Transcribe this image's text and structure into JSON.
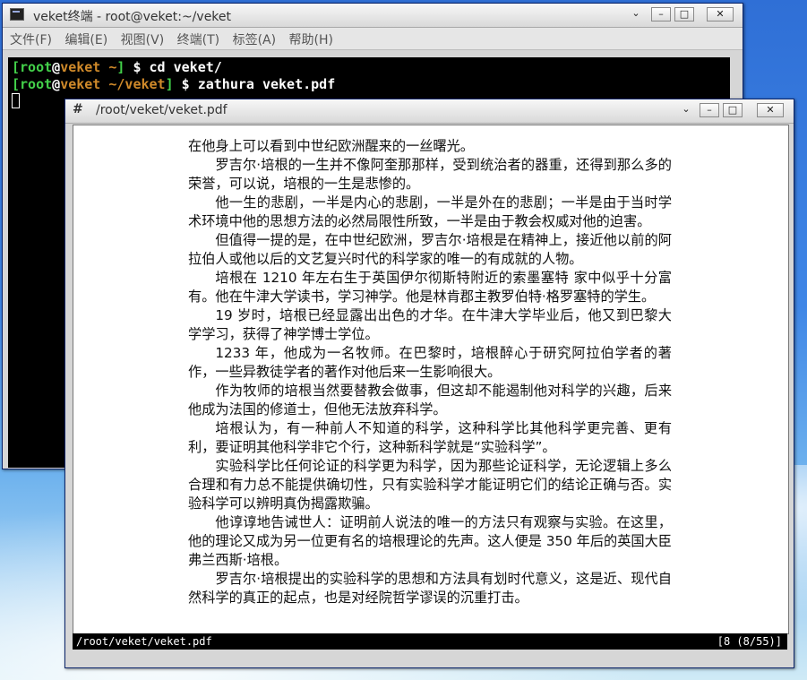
{
  "terminal": {
    "title": "veket终端 - root@veket:~/veket",
    "menu": [
      "文件(F)",
      "编辑(E)",
      "视图(V)",
      "终端(T)",
      "标签(A)",
      "帮助(H)"
    ],
    "lines": [
      {
        "bracket_open": "[",
        "user": "root",
        "at": "@",
        "host": "veket",
        "path": " ~",
        "bracket_close": "]",
        "prompt": " $ ",
        "command": "cd veket/"
      },
      {
        "bracket_open": "[",
        "user": "root",
        "at": "@",
        "host": "veket",
        "path": " ~/veket",
        "bracket_close": "]",
        "prompt": " $ ",
        "command": "zathura veket.pdf"
      }
    ]
  },
  "viewer": {
    "title": "/root/veket/veket.pdf",
    "title_glyph": "#",
    "status_path": "/root/veket/veket.pdf",
    "status_page": "[8 (8/55)]",
    "paragraphs": [
      "在他身上可以看到中世纪欧洲醒来的一丝曙光。",
      "罗吉尔·培根的一生并不像阿奎那那样，受到统治者的器重，还得到那么多的荣誉，可以说，培根的一生是悲惨的。",
      "他一生的悲剧，一半是内心的悲剧，一半是外在的悲剧；一半是由于当时学术环境中他的思想方法的必然局限性所致，一半是由于教会权威对他的迫害。",
      "但值得一提的是，在中世纪欧洲，罗吉尔·培根是在精神上，接近他以前的阿拉伯人或他以后的文艺复兴时代的科学家的唯一的有成就的人物。",
      "培根在 1210 年左右生于英国伊尔彻斯特附近的索墨塞特 家中似乎十分富有。他在牛津大学读书，学习神学。他是林肯郡主教罗伯特·格罗塞特的学生。",
      "19 岁时，培根已经显露出出色的才华。在牛津大学毕业后，他又到巴黎大学学习，获得了神学博士学位。",
      "1233 年，他成为一名牧师。在巴黎时，培根醉心于研究阿拉伯学者的著作，一些异教徒学者的著作对他后来一生影响很大。",
      "作为牧师的培根当然要替教会做事，但这却不能遏制他对科学的兴趣，后来他成为法国的修道士，但他无法放弃科学。",
      "培根认为，有一种前人不知道的科学，这种科学比其他科学更完善、更有利，要证明其他科学非它个行，这种新科学就是“实验科学”。",
      "实验科学比任何论证的科学更为科学，因为那些论证科学，无论逻辑上多么合理和有力总不能提供确切性，只有实验科学才能证明它们的结论正确与否。实验科学可以辨明真伪揭露欺骗。",
      "他谆谆地告诫世人：证明前人说法的唯一的方法只有观察与实验。在这里，他的理论又成为另一位更有名的培根理论的先声。这人便是 350 年后的英国大臣弗兰西斯·培根。",
      "罗吉尔·培根提出的实验科学的思想和方法具有划时代意义，这是近、现代自然科学的真正的起点，也是对经院哲学谬误的沉重打击。"
    ]
  },
  "window_buttons": {
    "menu": "⌄",
    "minimize": "–",
    "maximize": "□",
    "close": "✕"
  }
}
